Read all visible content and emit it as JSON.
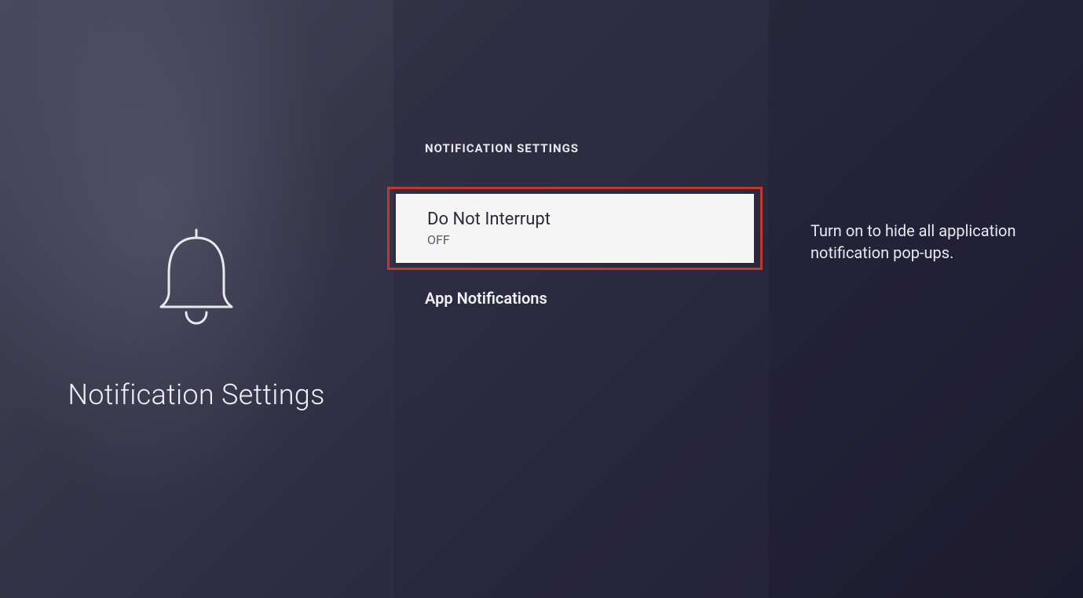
{
  "page": {
    "title": "Notification Settings",
    "section_header": "NOTIFICATION SETTINGS"
  },
  "menu": {
    "items": [
      {
        "title": "Do Not Interrupt",
        "status": "OFF",
        "description": "Turn on to hide all application notification pop-ups."
      },
      {
        "title": "App Notifications"
      }
    ]
  }
}
